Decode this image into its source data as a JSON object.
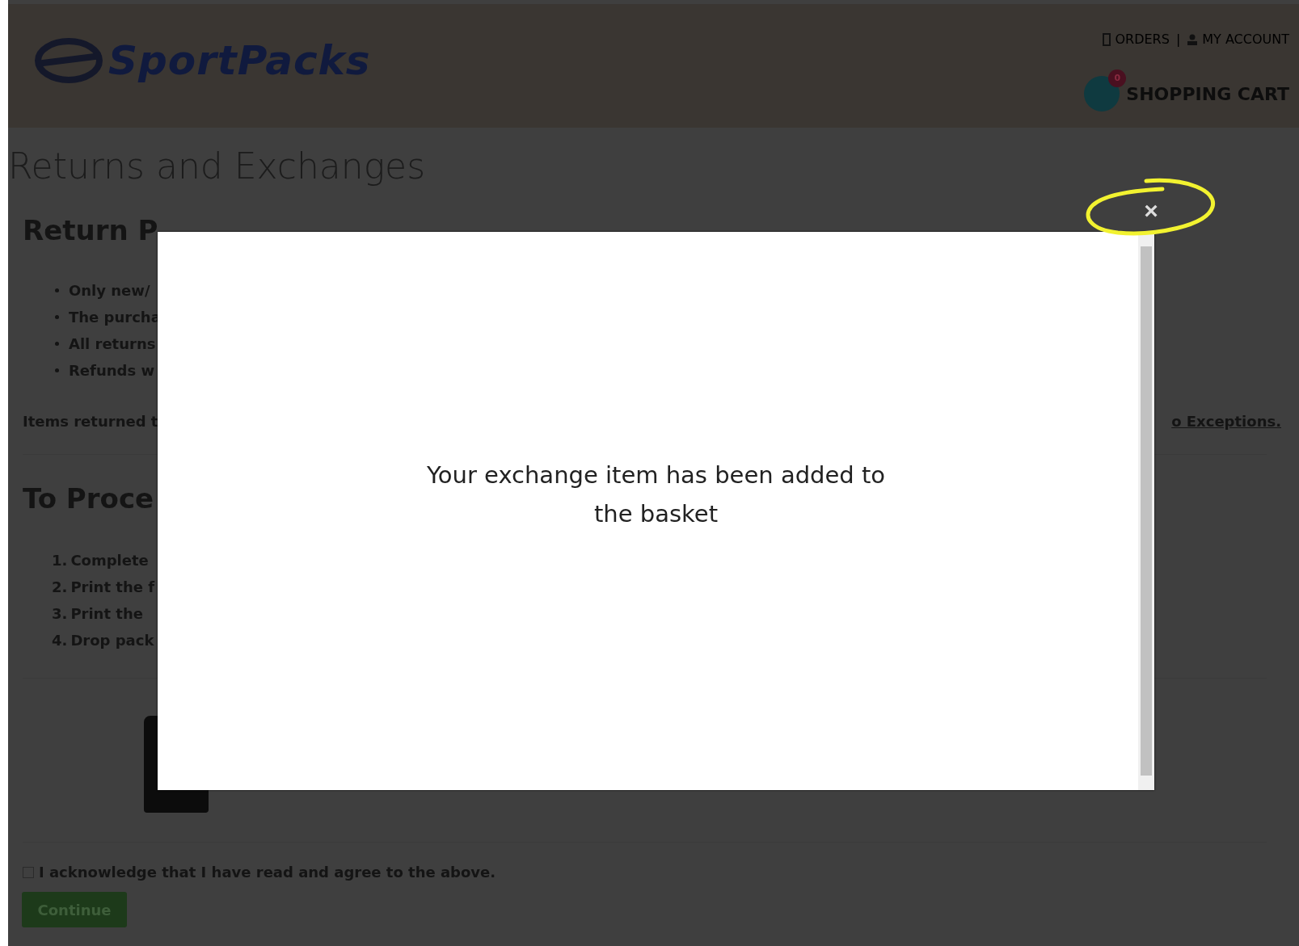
{
  "header": {
    "logo_text": "SportPacks",
    "links": [
      {
        "label": "ORDERS"
      },
      {
        "label": "MY ACCOUNT"
      }
    ],
    "separator": "|",
    "cart": {
      "label": "SHOPPING CART",
      "count": "0"
    }
  },
  "page_title": "Returns and Exchanges",
  "policy": {
    "heading": "Return P",
    "bullets": [
      "Only new/",
      "The purcha",
      "All returns",
      "Refunds w"
    ],
    "note": "Items returned t",
    "note_end": "o Exceptions."
  },
  "process": {
    "heading": "To Proce",
    "steps": [
      {
        "number": "1.",
        "text": "Complete"
      },
      {
        "number": "2.",
        "text": "Print the f"
      },
      {
        "number": "3.",
        "text": "Print the"
      },
      {
        "number": "4.",
        "text": "Drop pack"
      }
    ]
  },
  "acknowledge": {
    "label": "I acknowledge that I have read and agree to the above.",
    "checked": false
  },
  "continue_button": "Continue",
  "modal": {
    "message": "Your exchange item has been added to the basket",
    "close": "×"
  }
}
